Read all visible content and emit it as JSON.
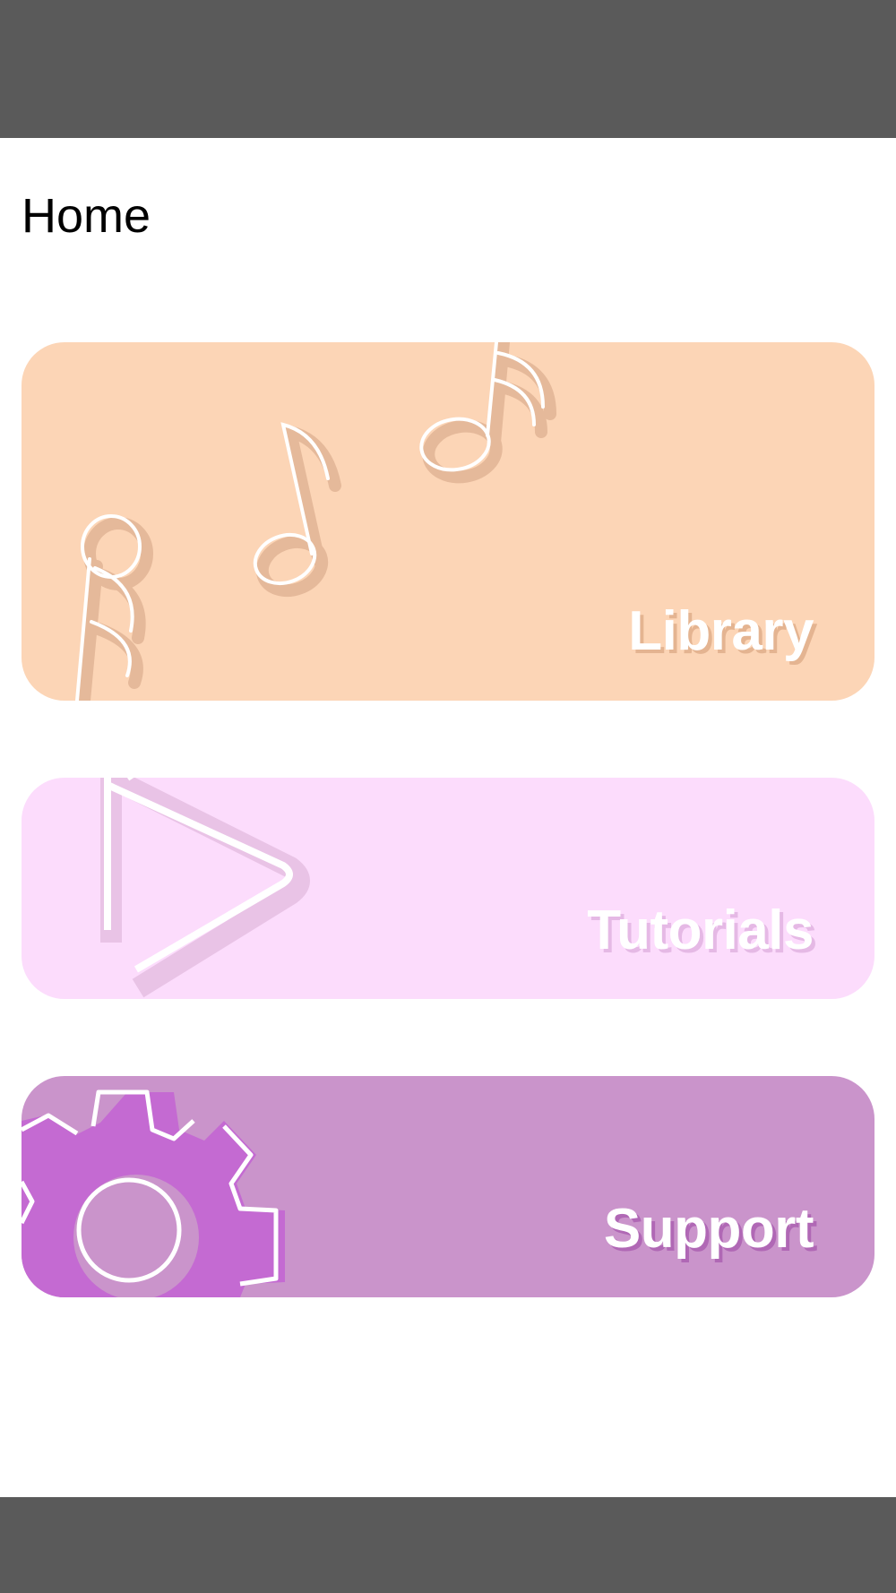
{
  "page": {
    "title": "Home"
  },
  "cards": [
    {
      "label": "Library",
      "icon": "music-notes-icon",
      "background": "#fcd5b6",
      "icon_shadow": "#e5b99a"
    },
    {
      "label": "Tutorials",
      "icon": "play-icon",
      "background": "#fcdcfc",
      "icon_shadow": "#e9c3e6"
    },
    {
      "label": "Support",
      "icon": "gear-icon",
      "background": "#ca94cb",
      "icon_shadow": "#c46ad2"
    }
  ],
  "colors": {
    "system_bars": "#5a5a5a",
    "page_background": "#ffffff",
    "label_text": "#ffffff"
  }
}
